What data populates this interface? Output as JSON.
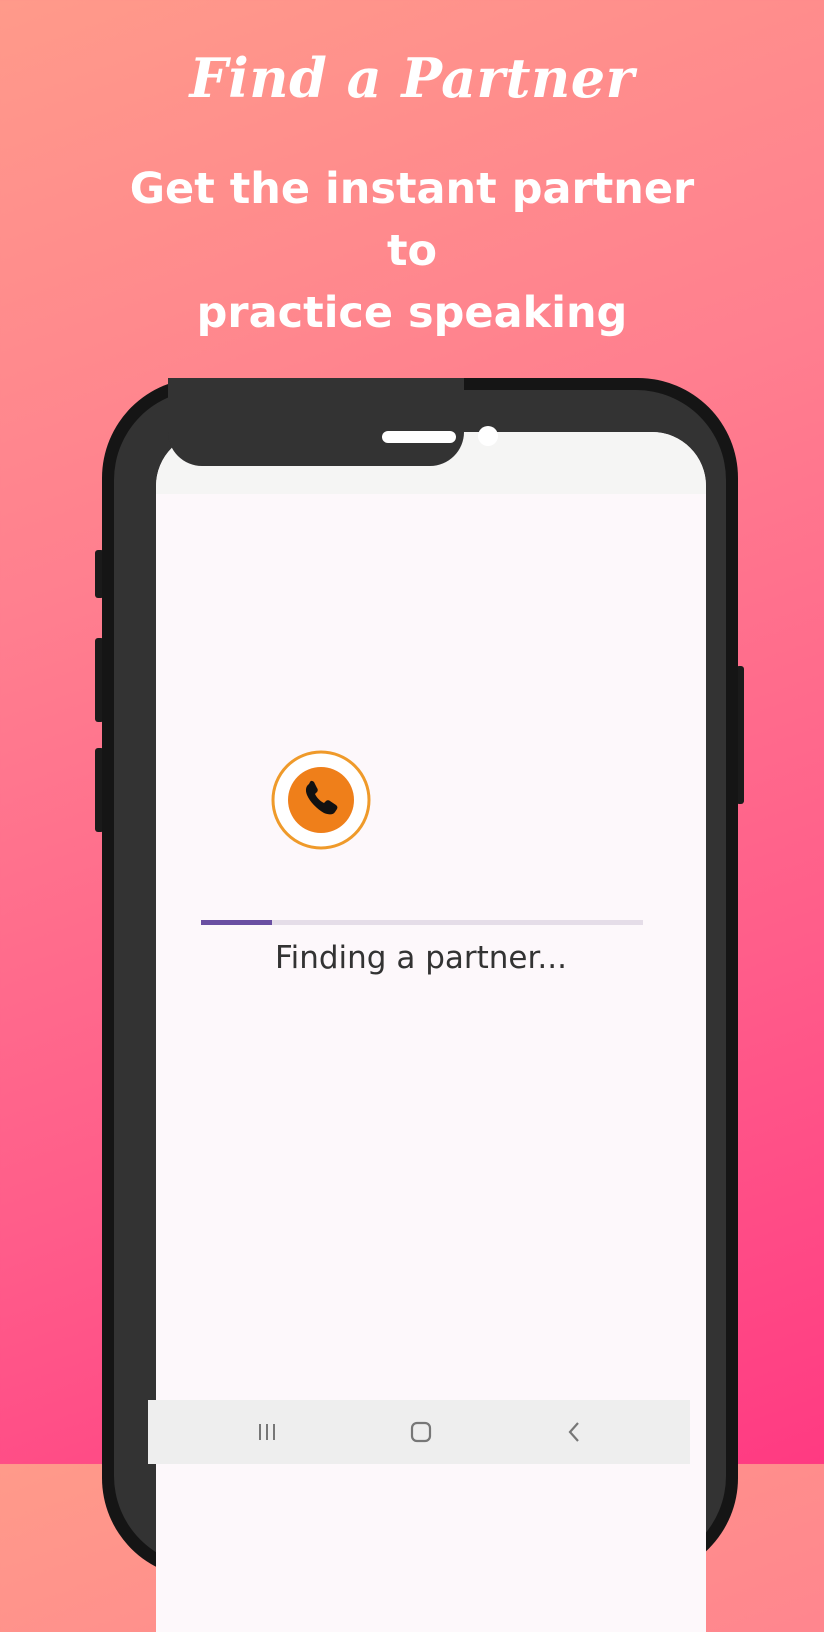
{
  "promo": {
    "title": "Find a Partner",
    "subtitle_line1": "Get the instant partner to",
    "subtitle_line2": "practice speaking"
  },
  "screen": {
    "call_icon": "phone-call-icon",
    "progress": 0.16,
    "status_text": "Finding a partner..."
  },
  "navbar": {
    "recents_icon": "recents-icon",
    "home_icon": "home-icon",
    "back_icon": "back-icon"
  },
  "colors": {
    "accent_orange": "#ef7f1a",
    "progress": "#6a4fa2",
    "gradient_top": "#ff9a8a",
    "gradient_bottom": "#ff3a82"
  }
}
